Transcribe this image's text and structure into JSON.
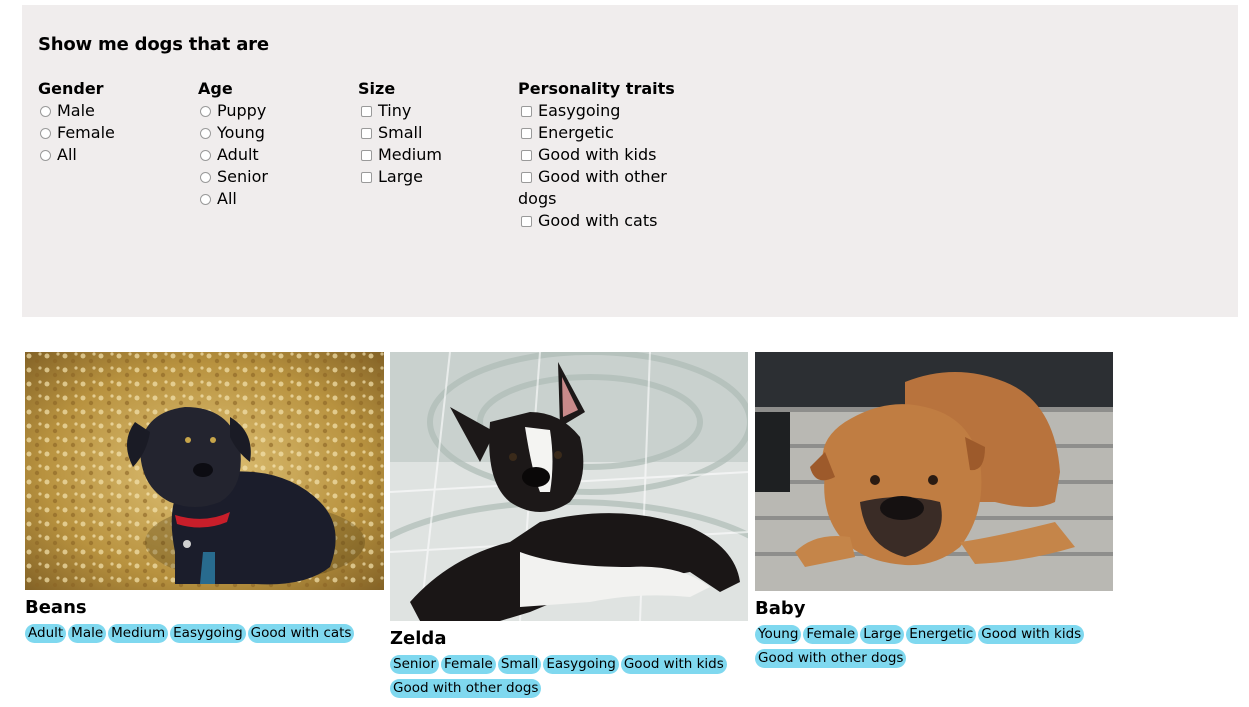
{
  "filters": {
    "heading": "Show me dogs that are",
    "gender": {
      "title": "Gender",
      "options": [
        "Male",
        "Female",
        "All"
      ]
    },
    "age": {
      "title": "Age",
      "options": [
        "Puppy",
        "Young",
        "Adult",
        "Senior",
        "All"
      ]
    },
    "size": {
      "title": "Size",
      "options": [
        "Tiny",
        "Small",
        "Medium",
        "Large"
      ]
    },
    "personality": {
      "title": "Personality traits",
      "options": [
        "Easygoing",
        "Energetic",
        "Good with kids",
        "Good with other dogs",
        "Good with cats"
      ]
    }
  },
  "dogs": [
    {
      "name": "Beans",
      "tags": [
        "Adult",
        "Male",
        "Medium",
        "Easygoing",
        "Good with cats"
      ]
    },
    {
      "name": "Zelda",
      "tags": [
        "Senior",
        "Female",
        "Small",
        "Easygoing",
        "Good with kids",
        "Good with other dogs"
      ]
    },
    {
      "name": "Baby",
      "tags": [
        "Young",
        "Female",
        "Large",
        "Energetic",
        "Good with kids",
        "Good with other dogs"
      ]
    }
  ],
  "colors": {
    "panel_bg": "#f0eded",
    "tag_bg": "#7fd8ef"
  }
}
